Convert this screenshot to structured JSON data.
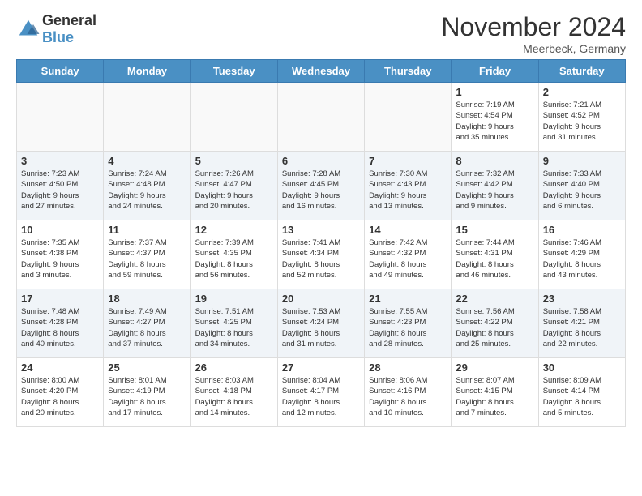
{
  "header": {
    "logo_general": "General",
    "logo_blue": "Blue",
    "month_title": "November 2024",
    "location": "Meerbeck, Germany"
  },
  "calendar": {
    "day_headers": [
      "Sunday",
      "Monday",
      "Tuesday",
      "Wednesday",
      "Thursday",
      "Friday",
      "Saturday"
    ],
    "weeks": [
      [
        {
          "day": "",
          "info": ""
        },
        {
          "day": "",
          "info": ""
        },
        {
          "day": "",
          "info": ""
        },
        {
          "day": "",
          "info": ""
        },
        {
          "day": "",
          "info": ""
        },
        {
          "day": "1",
          "info": "Sunrise: 7:19 AM\nSunset: 4:54 PM\nDaylight: 9 hours\nand 35 minutes."
        },
        {
          "day": "2",
          "info": "Sunrise: 7:21 AM\nSunset: 4:52 PM\nDaylight: 9 hours\nand 31 minutes."
        }
      ],
      [
        {
          "day": "3",
          "info": "Sunrise: 7:23 AM\nSunset: 4:50 PM\nDaylight: 9 hours\nand 27 minutes."
        },
        {
          "day": "4",
          "info": "Sunrise: 7:24 AM\nSunset: 4:48 PM\nDaylight: 9 hours\nand 24 minutes."
        },
        {
          "day": "5",
          "info": "Sunrise: 7:26 AM\nSunset: 4:47 PM\nDaylight: 9 hours\nand 20 minutes."
        },
        {
          "day": "6",
          "info": "Sunrise: 7:28 AM\nSunset: 4:45 PM\nDaylight: 9 hours\nand 16 minutes."
        },
        {
          "day": "7",
          "info": "Sunrise: 7:30 AM\nSunset: 4:43 PM\nDaylight: 9 hours\nand 13 minutes."
        },
        {
          "day": "8",
          "info": "Sunrise: 7:32 AM\nSunset: 4:42 PM\nDaylight: 9 hours\nand 9 minutes."
        },
        {
          "day": "9",
          "info": "Sunrise: 7:33 AM\nSunset: 4:40 PM\nDaylight: 9 hours\nand 6 minutes."
        }
      ],
      [
        {
          "day": "10",
          "info": "Sunrise: 7:35 AM\nSunset: 4:38 PM\nDaylight: 9 hours\nand 3 minutes."
        },
        {
          "day": "11",
          "info": "Sunrise: 7:37 AM\nSunset: 4:37 PM\nDaylight: 8 hours\nand 59 minutes."
        },
        {
          "day": "12",
          "info": "Sunrise: 7:39 AM\nSunset: 4:35 PM\nDaylight: 8 hours\nand 56 minutes."
        },
        {
          "day": "13",
          "info": "Sunrise: 7:41 AM\nSunset: 4:34 PM\nDaylight: 8 hours\nand 52 minutes."
        },
        {
          "day": "14",
          "info": "Sunrise: 7:42 AM\nSunset: 4:32 PM\nDaylight: 8 hours\nand 49 minutes."
        },
        {
          "day": "15",
          "info": "Sunrise: 7:44 AM\nSunset: 4:31 PM\nDaylight: 8 hours\nand 46 minutes."
        },
        {
          "day": "16",
          "info": "Sunrise: 7:46 AM\nSunset: 4:29 PM\nDaylight: 8 hours\nand 43 minutes."
        }
      ],
      [
        {
          "day": "17",
          "info": "Sunrise: 7:48 AM\nSunset: 4:28 PM\nDaylight: 8 hours\nand 40 minutes."
        },
        {
          "day": "18",
          "info": "Sunrise: 7:49 AM\nSunset: 4:27 PM\nDaylight: 8 hours\nand 37 minutes."
        },
        {
          "day": "19",
          "info": "Sunrise: 7:51 AM\nSunset: 4:25 PM\nDaylight: 8 hours\nand 34 minutes."
        },
        {
          "day": "20",
          "info": "Sunrise: 7:53 AM\nSunset: 4:24 PM\nDaylight: 8 hours\nand 31 minutes."
        },
        {
          "day": "21",
          "info": "Sunrise: 7:55 AM\nSunset: 4:23 PM\nDaylight: 8 hours\nand 28 minutes."
        },
        {
          "day": "22",
          "info": "Sunrise: 7:56 AM\nSunset: 4:22 PM\nDaylight: 8 hours\nand 25 minutes."
        },
        {
          "day": "23",
          "info": "Sunrise: 7:58 AM\nSunset: 4:21 PM\nDaylight: 8 hours\nand 22 minutes."
        }
      ],
      [
        {
          "day": "24",
          "info": "Sunrise: 8:00 AM\nSunset: 4:20 PM\nDaylight: 8 hours\nand 20 minutes."
        },
        {
          "day": "25",
          "info": "Sunrise: 8:01 AM\nSunset: 4:19 PM\nDaylight: 8 hours\nand 17 minutes."
        },
        {
          "day": "26",
          "info": "Sunrise: 8:03 AM\nSunset: 4:18 PM\nDaylight: 8 hours\nand 14 minutes."
        },
        {
          "day": "27",
          "info": "Sunrise: 8:04 AM\nSunset: 4:17 PM\nDaylight: 8 hours\nand 12 minutes."
        },
        {
          "day": "28",
          "info": "Sunrise: 8:06 AM\nSunset: 4:16 PM\nDaylight: 8 hours\nand 10 minutes."
        },
        {
          "day": "29",
          "info": "Sunrise: 8:07 AM\nSunset: 4:15 PM\nDaylight: 8 hours\nand 7 minutes."
        },
        {
          "day": "30",
          "info": "Sunrise: 8:09 AM\nSunset: 4:14 PM\nDaylight: 8 hours\nand 5 minutes."
        }
      ]
    ]
  }
}
